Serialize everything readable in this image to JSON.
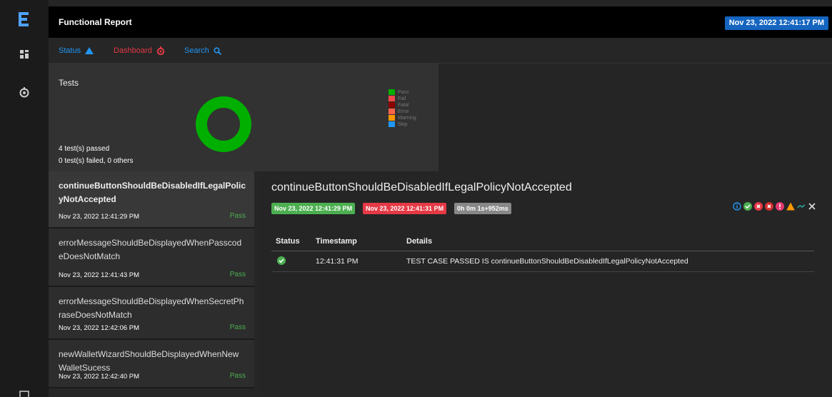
{
  "header": {
    "title": "Functional Report",
    "date": "Nov 23, 2022 12:41:17 PM"
  },
  "nav": {
    "status_label": "Status",
    "dashboard_label": "Dashboard",
    "search_label": "Search"
  },
  "summary": {
    "label": "Tests",
    "passed_text": "4 test(s) passed",
    "failed_text": "0 test(s) failed, 0 others",
    "chart_data": {
      "type": "pie",
      "categories": [
        "Pass",
        "Fail",
        "Fatal",
        "Error",
        "Warning",
        "Skip"
      ],
      "values": [
        4,
        0,
        0,
        0,
        0,
        0
      ],
      "colors": [
        "#00af00",
        "#f7464a",
        "#8b0000",
        "#ff6347",
        "#ff9800",
        "#2196f3"
      ]
    },
    "legend": [
      {
        "label": "Pass",
        "color": "#00af00"
      },
      {
        "label": "Fail",
        "color": "#f7464a"
      },
      {
        "label": "Fatal",
        "color": "#8b0000"
      },
      {
        "label": "Error",
        "color": "#ff6347"
      },
      {
        "label": "Warning",
        "color": "#ff9800"
      },
      {
        "label": "Skip",
        "color": "#2196f3"
      }
    ]
  },
  "tests": [
    {
      "name": "continueButtonShouldBeDisabledIfLegalPolicyNotAccepted",
      "time": "Nov 23, 2022 12:41:29 PM",
      "status": "Pass"
    },
    {
      "name": "errorMessageShouldBeDisplayedWhenPasscodeDoesNotMatch",
      "time": "Nov 23, 2022 12:41:43 PM",
      "status": "Pass"
    },
    {
      "name": "errorMessageShouldBeDisplayedWhenSecretPhraseDoesNotMatch",
      "time": "Nov 23, 2022 12:42:06 PM",
      "status": "Pass"
    },
    {
      "name": "newWalletWizardShouldBeDisplayedWhenNewWalletSucess",
      "time": "Nov 23, 2022 12:42:40 PM",
      "status": "Pass"
    }
  ],
  "detail": {
    "title": "continueButtonShouldBeDisabledIfLegalPolicyNotAccepted",
    "start": "Nov 23, 2022 12:41:29 PM",
    "end": "Nov 23, 2022 12:41:31 PM",
    "duration": "0h 0m 1s+952ms",
    "columns": [
      "Status",
      "Timestamp",
      "Details"
    ],
    "rows": [
      {
        "status": "pass",
        "timestamp": "12:41:31 PM",
        "details": "TEST CASE PASSED IS continueButtonShouldBeDisabledIfLegalPolicyNotAccepted"
      }
    ]
  }
}
